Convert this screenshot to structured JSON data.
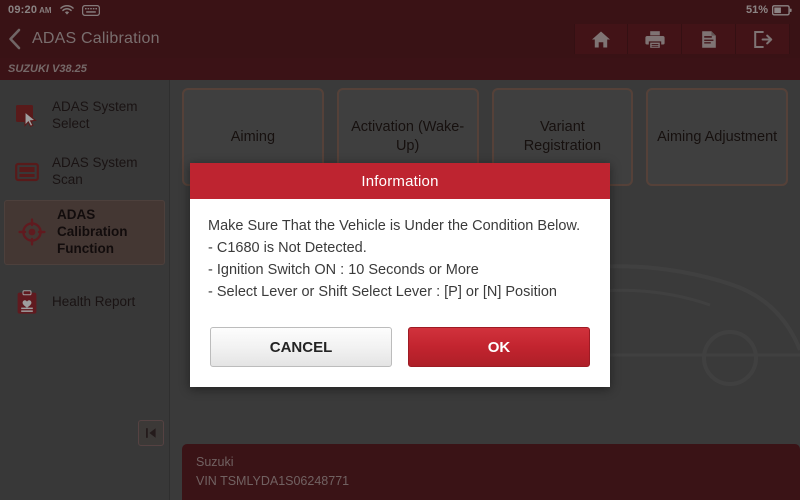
{
  "statusbar": {
    "time": "09:20",
    "ampm": "AM",
    "wifi_icon": "wifi-icon",
    "keyboard_icon": "keyboard-icon",
    "battery_percent": "51%",
    "battery_icon": "battery-half-icon"
  },
  "titlebar": {
    "back_icon": "back-chevron-icon",
    "title": "ADAS Calibration",
    "buttons": [
      {
        "name": "home-button",
        "icon": "home-icon"
      },
      {
        "name": "print-button",
        "icon": "printer-icon"
      },
      {
        "name": "report-button",
        "icon": "adas-report-icon"
      },
      {
        "name": "exit-button",
        "icon": "exit-icon"
      }
    ]
  },
  "versionbar": {
    "text": "SUZUKI V38.25"
  },
  "sidebar": {
    "items": [
      {
        "label": "ADAS System Select",
        "icon": "cursor-select-icon",
        "active": false
      },
      {
        "label": "ADAS System Scan",
        "icon": "scan-frame-icon",
        "active": false
      },
      {
        "label": "ADAS Calibration Function",
        "icon": "crosshair-target-icon",
        "active": true
      },
      {
        "label": "Health Report",
        "icon": "clipboard-heart-icon",
        "active": false
      }
    ],
    "collapse_icon": "collapse-left-icon"
  },
  "content": {
    "tiles": [
      {
        "label": "Aiming"
      },
      {
        "label": "Activation (Wake-Up)"
      },
      {
        "label": "Variant Registration"
      },
      {
        "label": "Aiming Adjustment"
      }
    ]
  },
  "vehicle": {
    "make": "Suzuki",
    "vin": "VIN TSMLYDA1S06248771"
  },
  "dialog": {
    "title": "Information",
    "lines": [
      "Make Sure That the Vehicle is Under the Condition Below.",
      "- C1680 is Not Detected.",
      "- Ignition Switch ON : 10 Seconds or More",
      "- Select Lever or Shift Select Lever : [P] or [N] Position"
    ],
    "cancel_label": "CANCEL",
    "ok_label": "OK"
  },
  "colors": {
    "brand_dark_red": "#5e1d22",
    "dialog_header_red": "#be2430",
    "ok_button_red": "#c2242f",
    "sidebar_gray": "#5b5b5b",
    "content_gray": "#5e5e5e",
    "tile_border_brown": "#8a6a5c",
    "active_item_brown": "#6e5953"
  }
}
